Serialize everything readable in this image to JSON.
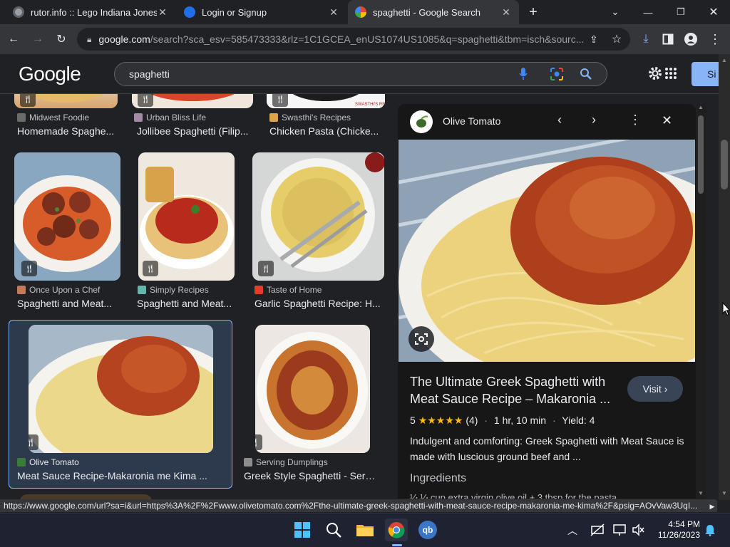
{
  "tabs": [
    {
      "title": "rutor.info :: Lego Indiana Jones 2",
      "favicon": "rutor-favicon"
    },
    {
      "title": "Login or Signup",
      "favicon": "bird-favicon"
    },
    {
      "title": "spaghetti - Google Search",
      "favicon": "google-favicon",
      "active": true
    }
  ],
  "address": {
    "host": "google.com",
    "path": "/search?sca_esv=585473333&rlz=1C1GCEA_enUS1074US1085&q=spaghetti&tbm=isch&sourc..."
  },
  "google": {
    "logo": "Google",
    "query": "spaghetti",
    "signin_label": "Si"
  },
  "results": {
    "row0": [
      {
        "source": "Midwest Foodie",
        "title": "Homemade Spaghe..."
      },
      {
        "source": "Urban Bliss Life",
        "title": "Jollibee Spaghetti (Filip..."
      },
      {
        "source": "Swasthi's Recipes",
        "title": "Chicken Pasta (Chicke..."
      }
    ],
    "row1": [
      {
        "source": "Once Upon a Chef",
        "title": "Spaghetti and Meat..."
      },
      {
        "source": "Simply Recipes",
        "title": "Spaghetti and Meat..."
      },
      {
        "source": "Taste of Home",
        "title": "Garlic Spaghetti Recipe: H..."
      }
    ],
    "row2": [
      {
        "source": "Olive Tomato",
        "title": "Meat Sauce Recipe-Makaronia me Kima ...",
        "selected": true
      },
      {
        "source": "Serving Dumplings",
        "title": "Greek Style Spaghetti - Servi..."
      }
    ]
  },
  "preview": {
    "site": "Olive Tomato",
    "title": "The Ultimate Greek Spaghetti with Meat Sauce Recipe – Makaronia ...",
    "visit_label": "Visit",
    "rating_value": "5",
    "stars": "★★★★★",
    "rating_count": "(4)",
    "time": "1 hr, 10 min",
    "yield": "Yield: 4",
    "sep": "·",
    "description": "Indulgent and comforting: Greek Spaghetti with Meat Sauce is made with luscious ground beef and ...",
    "section": "Ingredients",
    "first_line": "¼ ¼ cup extra virgin olive oil + 3 tbsp for the pasta"
  },
  "status_url": "https://www.google.com/url?sa=i&url=https%3A%2F%2Fwww.olivetomato.com%2Fthe-ultimate-greek-spaghetti-with-meat-sauce-recipe-makaronia-me-kima%2F&psig=AOvVaw3UqI...",
  "taskbar": {
    "time": "4:54 PM",
    "date": "11/26/2023",
    "qb_label": "qb"
  },
  "colors": {
    "accent": "#8ab4f8",
    "star": "#fbbc04",
    "chrome_blue": "#1a73e8"
  }
}
